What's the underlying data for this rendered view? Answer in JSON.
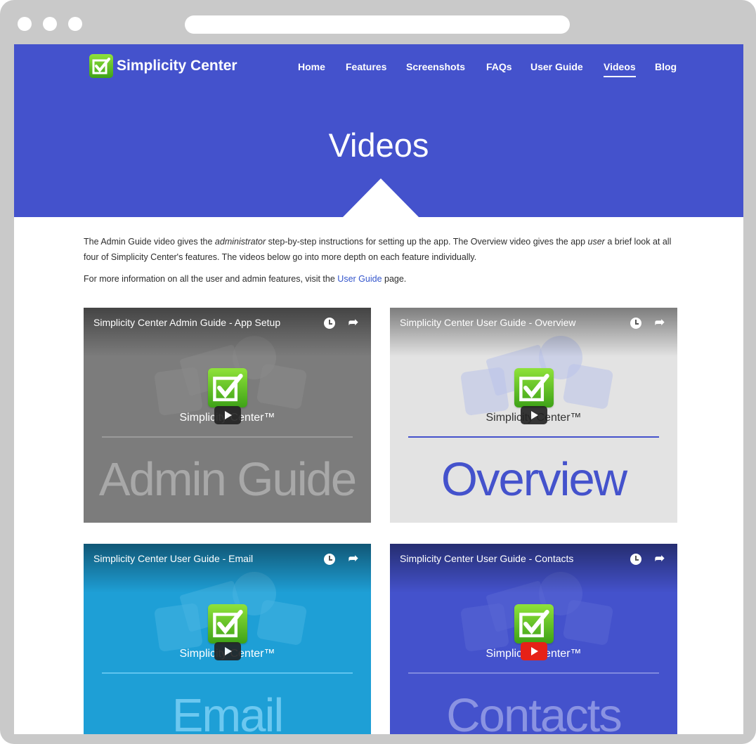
{
  "site": {
    "name": "Simplicity Center",
    "brand_color": "#4452cc"
  },
  "nav": {
    "items": [
      {
        "label": "Home"
      },
      {
        "label": "Features"
      },
      {
        "label": "Screenshots"
      },
      {
        "label": "FAQs"
      },
      {
        "label": "User Guide"
      },
      {
        "label": "Videos",
        "active": true
      },
      {
        "label": "Blog"
      }
    ]
  },
  "page": {
    "title": "Videos",
    "intro_p1_a": "The Admin Guide video gives the ",
    "intro_p1_em1": "administrator",
    "intro_p1_b": " step-by-step instructions for setting up the app. The Overview video gives the app ",
    "intro_p1_em2": "user",
    "intro_p1_c": " a brief look at all four of Simplicity Center's features. The videos below go into more depth on each feature individually.",
    "intro_p2_a": "For more information on all the user and admin features, visit the ",
    "intro_p2_link": "User Guide",
    "intro_p2_b": " page."
  },
  "videos": [
    {
      "title": "Simplicity Center Admin Guide - App Setup",
      "brand": "Simplicity Center™",
      "big_text": "Admin Guide",
      "bg": "#7c7c7c",
      "fg": "#9a9a9a",
      "text_color": "#a8a8a8",
      "icon_tint": "#8a8a8a"
    },
    {
      "title": "Simplicity Center User Guide - Overview",
      "brand": "Simplicity Center™",
      "big_text": "Overview",
      "bg": "#e3e3e3",
      "fg": "#4452cc",
      "text_color": "#4452cc",
      "icon_tint": "#b9c2ea"
    },
    {
      "title": "Simplicity Center User Guide - Email",
      "brand": "Simplicity Center™",
      "big_text": "Email",
      "bg": "#1e9fd6",
      "fg": "#5fc4ef",
      "text_color": "#6cc8f0",
      "icon_tint": "#45b2e2"
    },
    {
      "title": "Simplicity Center User Guide - Contacts",
      "brand": "Simplicity Center™",
      "big_text": "Contacts",
      "bg": "#4452cc",
      "fg": "#7f89df",
      "text_color": "#8a93e2",
      "icon_tint": "#5a66d4"
    }
  ]
}
